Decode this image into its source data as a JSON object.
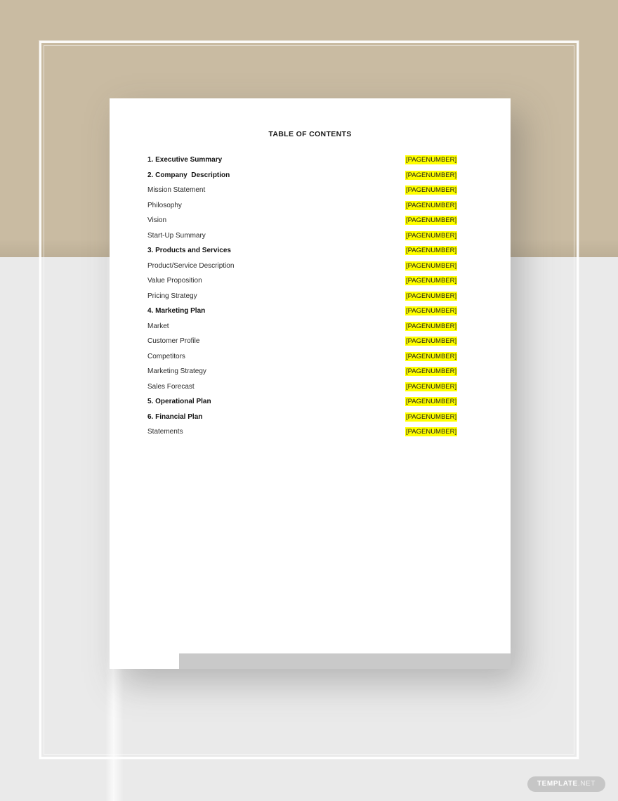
{
  "document": {
    "title": "TABLE OF CONTENTS",
    "page_label_text": "[PAGENUMBER]",
    "highlight_color": "#ffff00",
    "toc": [
      {
        "label": "1. Executive Summary",
        "bold": true,
        "page": "[PAGENUMBER]"
      },
      {
        "label": "2. Company  Description",
        "bold": true,
        "page": "[PAGENUMBER]"
      },
      {
        "label": "Mission Statement",
        "bold": false,
        "page": "[PAGENUMBER]"
      },
      {
        "label": "Philosophy",
        "bold": false,
        "page": "[PAGENUMBER]"
      },
      {
        "label": "Vision",
        "bold": false,
        "page": "[PAGENUMBER]"
      },
      {
        "label": "Start-Up Summary",
        "bold": false,
        "page": "[PAGENUMBER]"
      },
      {
        "label": "3. Products and Services",
        "bold": true,
        "page": "[PAGENUMBER]"
      },
      {
        "label": "Product/Service Description",
        "bold": false,
        "page": "[PAGENUMBER]"
      },
      {
        "label": "Value Proposition",
        "bold": false,
        "page": "[PAGENUMBER]"
      },
      {
        "label": "Pricing Strategy",
        "bold": false,
        "page": "[PAGENUMBER]"
      },
      {
        "label": "4. Marketing Plan",
        "bold": true,
        "page": "[PAGENUMBER]"
      },
      {
        "label": "Market",
        "bold": false,
        "page": "[PAGENUMBER]"
      },
      {
        "label": "Customer Profile",
        "bold": false,
        "page": "[PAGENUMBER]"
      },
      {
        "label": "Competitors",
        "bold": false,
        "page": "[PAGENUMBER]"
      },
      {
        "label": "Marketing Strategy",
        "bold": false,
        "page": "[PAGENUMBER]"
      },
      {
        "label": "Sales Forecast",
        "bold": false,
        "page": "[PAGENUMBER]"
      },
      {
        "label": "5. Operational Plan",
        "bold": true,
        "page": "[PAGENUMBER]"
      },
      {
        "label": "6. Financial Plan",
        "bold": true,
        "page": "[PAGENUMBER]"
      },
      {
        "label": "Statements",
        "bold": false,
        "page": "[PAGENUMBER]"
      }
    ]
  },
  "watermark": {
    "strong": "TEMPLATE",
    "light": ".NET"
  },
  "colors": {
    "backdrop_tan": "#c9bba2",
    "backdrop_grey": "#eaeaea",
    "page": "#ffffff",
    "footer_strip": "#c9c9c9",
    "highlight": "#ffff00",
    "watermark_pill": "#c6c6c6"
  }
}
